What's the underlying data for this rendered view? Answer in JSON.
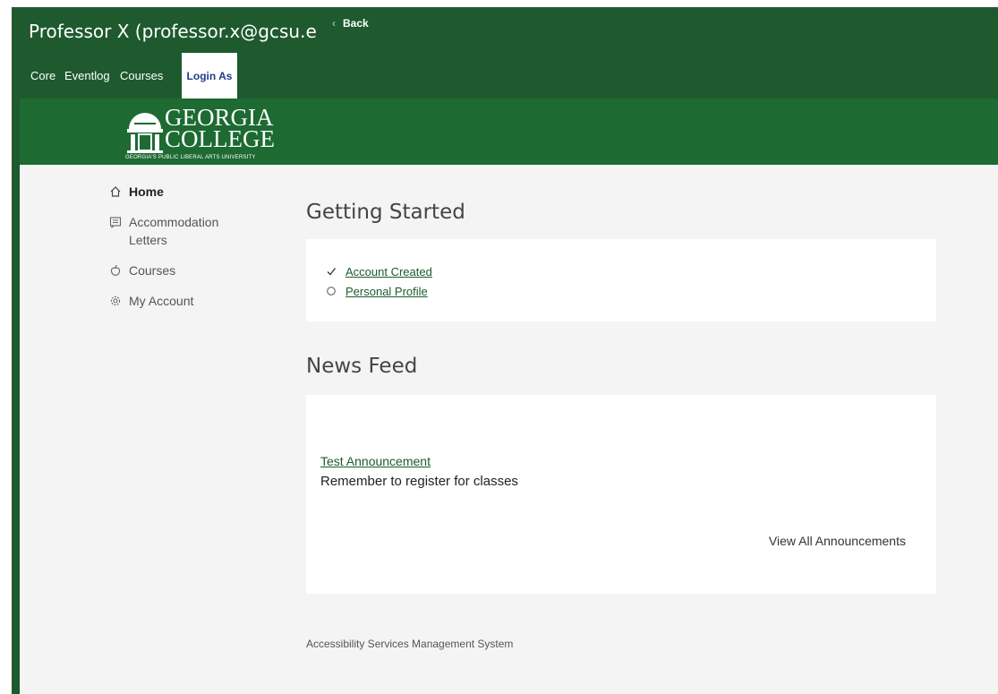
{
  "header": {
    "user_title": "Professor X (professor.x@gcsu.edu",
    "back_label": "Back"
  },
  "tabs": [
    {
      "label": "Core"
    },
    {
      "label": "Eventlog"
    },
    {
      "label": "Courses"
    },
    {
      "label": "Login As"
    }
  ],
  "brand": {
    "line1": "GEORGIA",
    "line2": "COLLEGE",
    "tagline": "GEORGIA'S PUBLIC LIBERAL ARTS UNIVERSITY"
  },
  "sidebar": {
    "items": [
      {
        "label": "Home",
        "icon": "home-icon",
        "active": true
      },
      {
        "label": "Accommodation Letters",
        "icon": "message-icon"
      },
      {
        "label": "Courses",
        "icon": "apple-icon"
      },
      {
        "label": "My Account",
        "icon": "gear-icon"
      }
    ]
  },
  "getting_started": {
    "title": "Getting Started",
    "items": [
      {
        "label": "Account Created",
        "status": "check-icon"
      },
      {
        "label": "Personal Profile",
        "status": "circle-icon"
      }
    ]
  },
  "news_feed": {
    "title": "News Feed",
    "announcement_title": "Test Announcement",
    "announcement_body": "Remember to register  for classes",
    "view_all_label": "View All Announcements"
  },
  "footer": {
    "text": "Accessibility Services Management System"
  },
  "colors": {
    "header_green": "#1e5a2e",
    "brand_green": "#1d6a32",
    "link_green": "#1c5a2e",
    "active_tab_text": "#1f3d8a"
  }
}
